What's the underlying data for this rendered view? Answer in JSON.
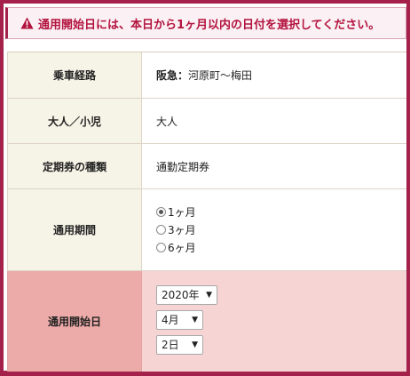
{
  "alert": {
    "message": "通用開始日には、本日から1ヶ月以内の日付を選択してください。",
    "color": "#b3123e"
  },
  "rows": {
    "route": {
      "label": "乗車経路",
      "value_bold": "阪急：",
      "value_rest": "河原町～梅田"
    },
    "passenger": {
      "label": "大人／小児",
      "value": "大人"
    },
    "ticket_type": {
      "label": "定期券の種類",
      "value": "通勤定期券"
    },
    "period": {
      "label": "通用期間",
      "options": [
        {
          "label": "1ヶ月",
          "selected": true
        },
        {
          "label": "3ヶ月",
          "selected": false
        },
        {
          "label": "6ヶ月",
          "selected": false
        }
      ]
    },
    "start_date": {
      "label": "通用開始日",
      "year": "2020年",
      "month": "4月",
      "day": "2日"
    }
  },
  "colors": {
    "frame": "#a3214b",
    "header_cell": "#f6f3e7",
    "highlight_header": "#ecaaa8",
    "highlight_cell": "#f6d4d4"
  }
}
